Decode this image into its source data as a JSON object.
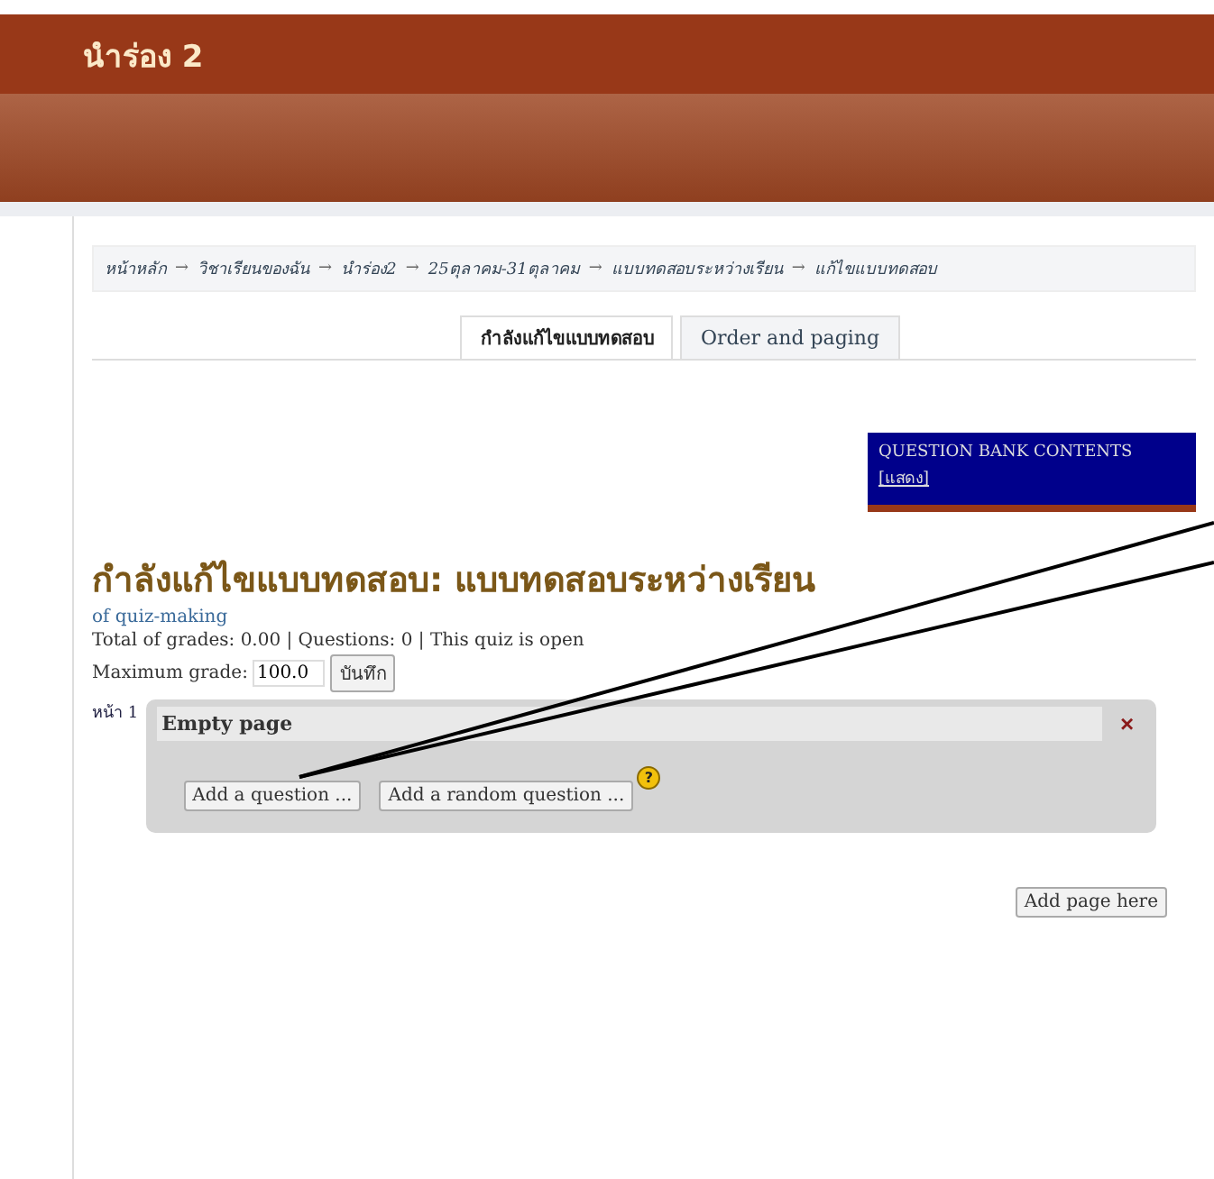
{
  "header": {
    "title": "นำร่อง 2"
  },
  "breadcrumb": {
    "separator": "→",
    "items": [
      "หน้าหลัก",
      "วิชาเรียนของฉัน",
      "นำร่อง2",
      "25ตุลาคม-31ตุลาคม",
      "แบบทดสอบระหว่างเรียน",
      "แก้ไขแบบทดสอบ"
    ]
  },
  "tabs": [
    {
      "label": "กำลังแก้ไขแบบทดสอบ",
      "selected": true
    },
    {
      "label": "Order and paging",
      "selected": false
    }
  ],
  "question_bank": {
    "title": "QUESTION BANK CONTENTS",
    "link": "[แสดง]"
  },
  "heading": "กำลังแก้ไขแบบทดสอบ: แบบทดสอบระหว่างเรียน",
  "subtitle": "of quiz-making",
  "summary": "Total of grades: 0.00 | Questions: 0 | This quiz is open",
  "max_grade": {
    "label": "Maximum grade:",
    "value": "100.0",
    "button": "บันทึก"
  },
  "pages": [
    {
      "label": "หน้า 1",
      "title": "Empty page",
      "close": "×",
      "buttons": [
        "Add a question ...",
        "Add a random question ..."
      ],
      "help": "?"
    }
  ],
  "add_page_button": "Add page here"
}
